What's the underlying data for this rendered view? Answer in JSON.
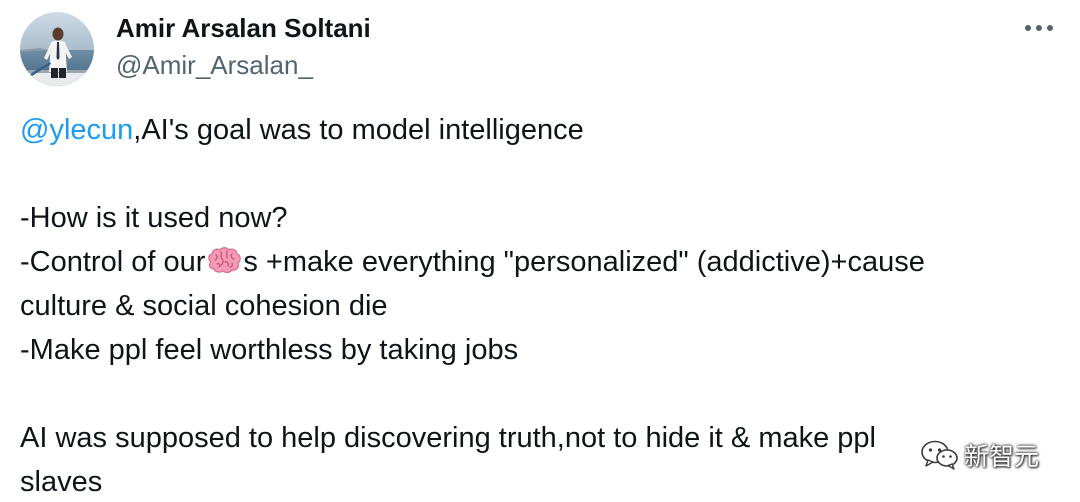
{
  "author": {
    "name": "Amir Arsalan Soltani",
    "handle": "@Amir_Arsalan_",
    "avatar_icon": "profile-photo"
  },
  "more_icon": "more-horizontal-icon",
  "tweet": {
    "mention": "@ylecun",
    "line1_rest": ",AI's goal was to model intelligence",
    "line2": "-How is it used now?",
    "line3_before": "-Control of our",
    "line3_emoji": "brain-emoji",
    "line3_after": "s +make everything \"personalized\" (addictive)+cause",
    "line4": "culture & social cohesion die",
    "line5": "-Make ppl feel worthless by taking jobs",
    "line6": "AI was supposed to help discovering truth,not to hide it & make ppl",
    "line7": "slaves"
  },
  "watermark": {
    "icon": "wechat-logo",
    "text": "新智元"
  },
  "colors": {
    "text": "#0f1419",
    "secondary": "#536471",
    "link": "#1d9bf0"
  }
}
